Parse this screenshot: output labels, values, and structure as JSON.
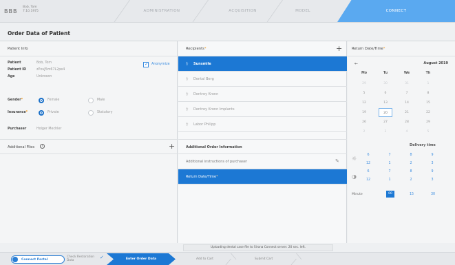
{
  "topbar": {
    "logo": "BBB",
    "patient_line1": "Bob, Tom",
    "patient_line2": "7.10.1975",
    "steps": [
      "ADMINISTRATION",
      "ACQUISITION",
      "MODEL",
      "CONNECT"
    ],
    "active_step": "CONNECT",
    "active_color": "#5aa9f0"
  },
  "page": {
    "title": "Order Data of Patient"
  },
  "patient_info": {
    "heading": "Patient Info",
    "fields": [
      {
        "label": "Patient",
        "value": "Bob, Tom"
      },
      {
        "label": "Patient ID",
        "value": "zPxuJ5m67L2pe4"
      },
      {
        "label": "Age",
        "value": "Unknown"
      }
    ],
    "anonymize_label": "Anonymize",
    "anonymize_checked": true,
    "gender": {
      "label": "Gender",
      "options": [
        "Female",
        "Male"
      ],
      "selected": "Female"
    },
    "insurance": {
      "label": "Insurance",
      "options": [
        "Private",
        "Statutory"
      ],
      "selected": "Private"
    },
    "purchaser": {
      "label": "Purchaser",
      "value": "Holger Mechler"
    },
    "additional_files": "Additional Files"
  },
  "recipients": {
    "heading": "Recipients",
    "items": [
      {
        "name": "Sunsmile",
        "selected": true
      },
      {
        "name": "Dental Berg",
        "selected": false
      },
      {
        "name": "Dentrey Kronn",
        "selected": false
      },
      {
        "name": "Dentrey Kronn Implants",
        "selected": false
      },
      {
        "name": "Labor Philipp",
        "selected": false
      }
    ],
    "additional_heading": "Additional Order Information",
    "instructions_placeholder": "Additional instructions of purchaser",
    "return_datetime_row": "Return Date/Time"
  },
  "calendar": {
    "heading": "Return Date/Time",
    "month": "August 2019",
    "dow": [
      "Mo",
      "Tu",
      "We",
      "Th"
    ],
    "rows": [
      [
        "29",
        "30",
        "31",
        "1"
      ],
      [
        "5",
        "6",
        "7",
        "8"
      ],
      [
        "12",
        "13",
        "14",
        "15"
      ],
      [
        "19",
        "20",
        "21",
        "22"
      ],
      [
        "26",
        "27",
        "28",
        "29"
      ],
      [
        "2",
        "3",
        "4",
        "5"
      ]
    ],
    "today": "20",
    "delivery_label": "Delivery time",
    "hours_row1": [
      "6",
      "7",
      "8",
      "9"
    ],
    "hours_row2": [
      "12",
      "1",
      "2",
      "3"
    ],
    "hours_row3": [
      "6",
      "7",
      "8",
      "9"
    ],
    "hours_row4": [
      "12",
      "1",
      "2",
      "3"
    ],
    "minute_label": "Minute",
    "minutes": [
      "00",
      "15",
      "30"
    ],
    "selected_minute": "00"
  },
  "status": {
    "text": "Uploading dental case file to Sirona Connect server. 20 sec. left."
  },
  "bottombar": {
    "home": "Connect Portal",
    "step1_line1": "Check Restoration",
    "step1_line2": "Data",
    "active": "Enter Order Data",
    "step3": "Add to Cart",
    "step4": "Submit Cart"
  }
}
